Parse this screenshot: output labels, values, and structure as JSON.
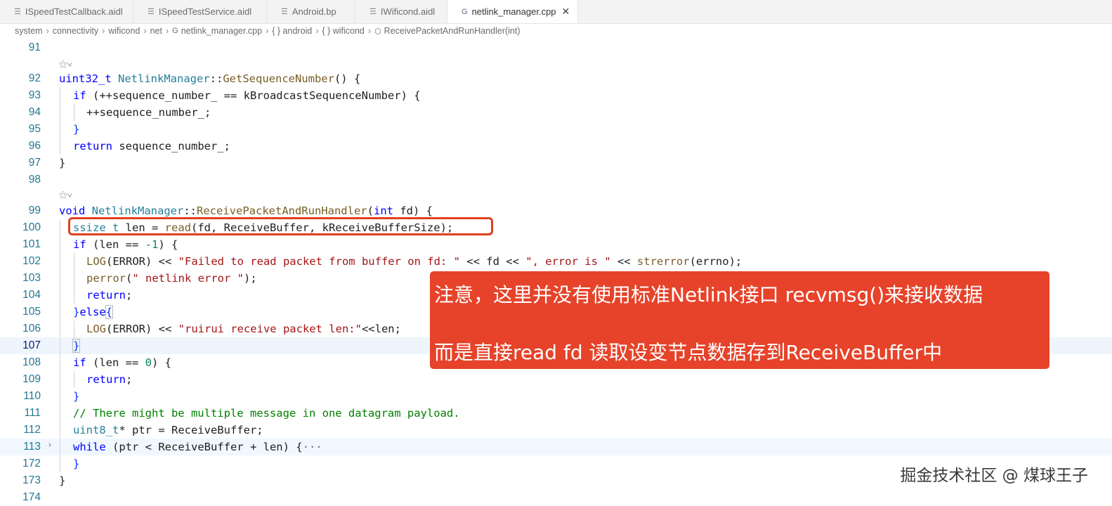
{
  "tabs": [
    {
      "label": "ISpeedTestCallback.aidl",
      "icon": "list-icon"
    },
    {
      "label": "ISpeedTestService.aidl",
      "icon": "list-icon"
    },
    {
      "label": "Android.bp",
      "icon": "list-icon"
    },
    {
      "label": "IWificond.aidl",
      "icon": "list-icon"
    },
    {
      "label": "netlink_manager.cpp",
      "icon": "cpp-file-icon",
      "close": "✕"
    }
  ],
  "breadcrumb": {
    "system": "system",
    "connectivity": "connectivity",
    "wificond": "wificond",
    "net": "net",
    "file": "netlink_manager.cpp",
    "ns_android": "{ } android",
    "ns_wificond": "{ } wificond",
    "method": "ReceivePacketAndRunHandler(int)"
  },
  "code": {
    "ln": {
      "l91": "91",
      "l92": "92",
      "l93": "93",
      "l94": "94",
      "l95": "95",
      "l96": "96",
      "l97": "97",
      "l98": "98",
      "l99": "99",
      "l100": "100",
      "l101": "101",
      "l102": "102",
      "l103": "103",
      "l104": "104",
      "l105": "105",
      "l106": "106",
      "l107": "107",
      "l108": "108",
      "l109": "109",
      "l110": "110",
      "l111": "111",
      "l112": "112",
      "l113": "113",
      "l172": "172",
      "l173": "173",
      "l174": "174"
    },
    "codelens": "⚝∨",
    "t": {
      "a1": "uint32_t",
      "a2": " ",
      "a3": "NetlinkManager",
      "a4": "::",
      "a5": "GetSequenceNumber",
      "a6": "() {",
      "b1": "if",
      "b2": " (++sequence_number_ == kBroadcastSequenceNumber) {",
      "c1": "++sequence_number_;",
      "d1": "}",
      "e1": "return",
      "e2": " sequence_number_;",
      "f1": "}",
      "g1": "void",
      "g2": " ",
      "g3": "NetlinkManager",
      "g4": "::",
      "g5": "ReceivePacketAndRunHandler",
      "g6": "(",
      "g7": "int",
      "g8": " fd) {",
      "h1": "ssize_t",
      "h2": " len = ",
      "h3": "read",
      "h4": "(fd, ReceiveBuffer, kReceiveBufferSize);",
      "i1": "if",
      "i2": " (len == ",
      "i3": "-1",
      "i4": ") {",
      "j1": "LOG",
      "j2": "(ERROR) << ",
      "j3": "\"Failed to read packet from buffer on fd: \"",
      "j4": " << fd << ",
      "j5": "\", error is \"",
      "j6": " << ",
      "j7": "strerror",
      "j8": "(errno);",
      "k1": "perror",
      "k2": "(",
      "k3": "\" netlink error \"",
      "k4": ");",
      "m1": "return",
      "m2": ";",
      "n1": "}",
      "n2": "else",
      "n3": "{",
      "o1": "LOG",
      "o2": "(ERROR) << ",
      "o3": "\"ruirui receive packet len:\"",
      "o4": "<<len;",
      "p1": "}",
      "q1": "if",
      "q2": " (len == ",
      "q3": "0",
      "q4": ") {",
      "r1": "return",
      "r2": ";",
      "s1": "}",
      "u1": "// There might be multiple message in one datagram payload.",
      "v1": "uint8_t",
      "v2": "* ptr = ReceiveBuffer;",
      "w1": "while",
      "w2": " (ptr < ReceiveBuffer + len) {",
      "w3": "···",
      "x1": "}",
      "y1": "}"
    }
  },
  "annotation": {
    "line1": "注意，这里并没有使用标准Netlink接口 recvmsg()来接收数据",
    "line2": "而是直接read fd 读取设变节点数据存到ReceiveBuffer中",
    "box_color": "#e6432a"
  },
  "watermark": "掘金技术社区 @ 煤球王子"
}
